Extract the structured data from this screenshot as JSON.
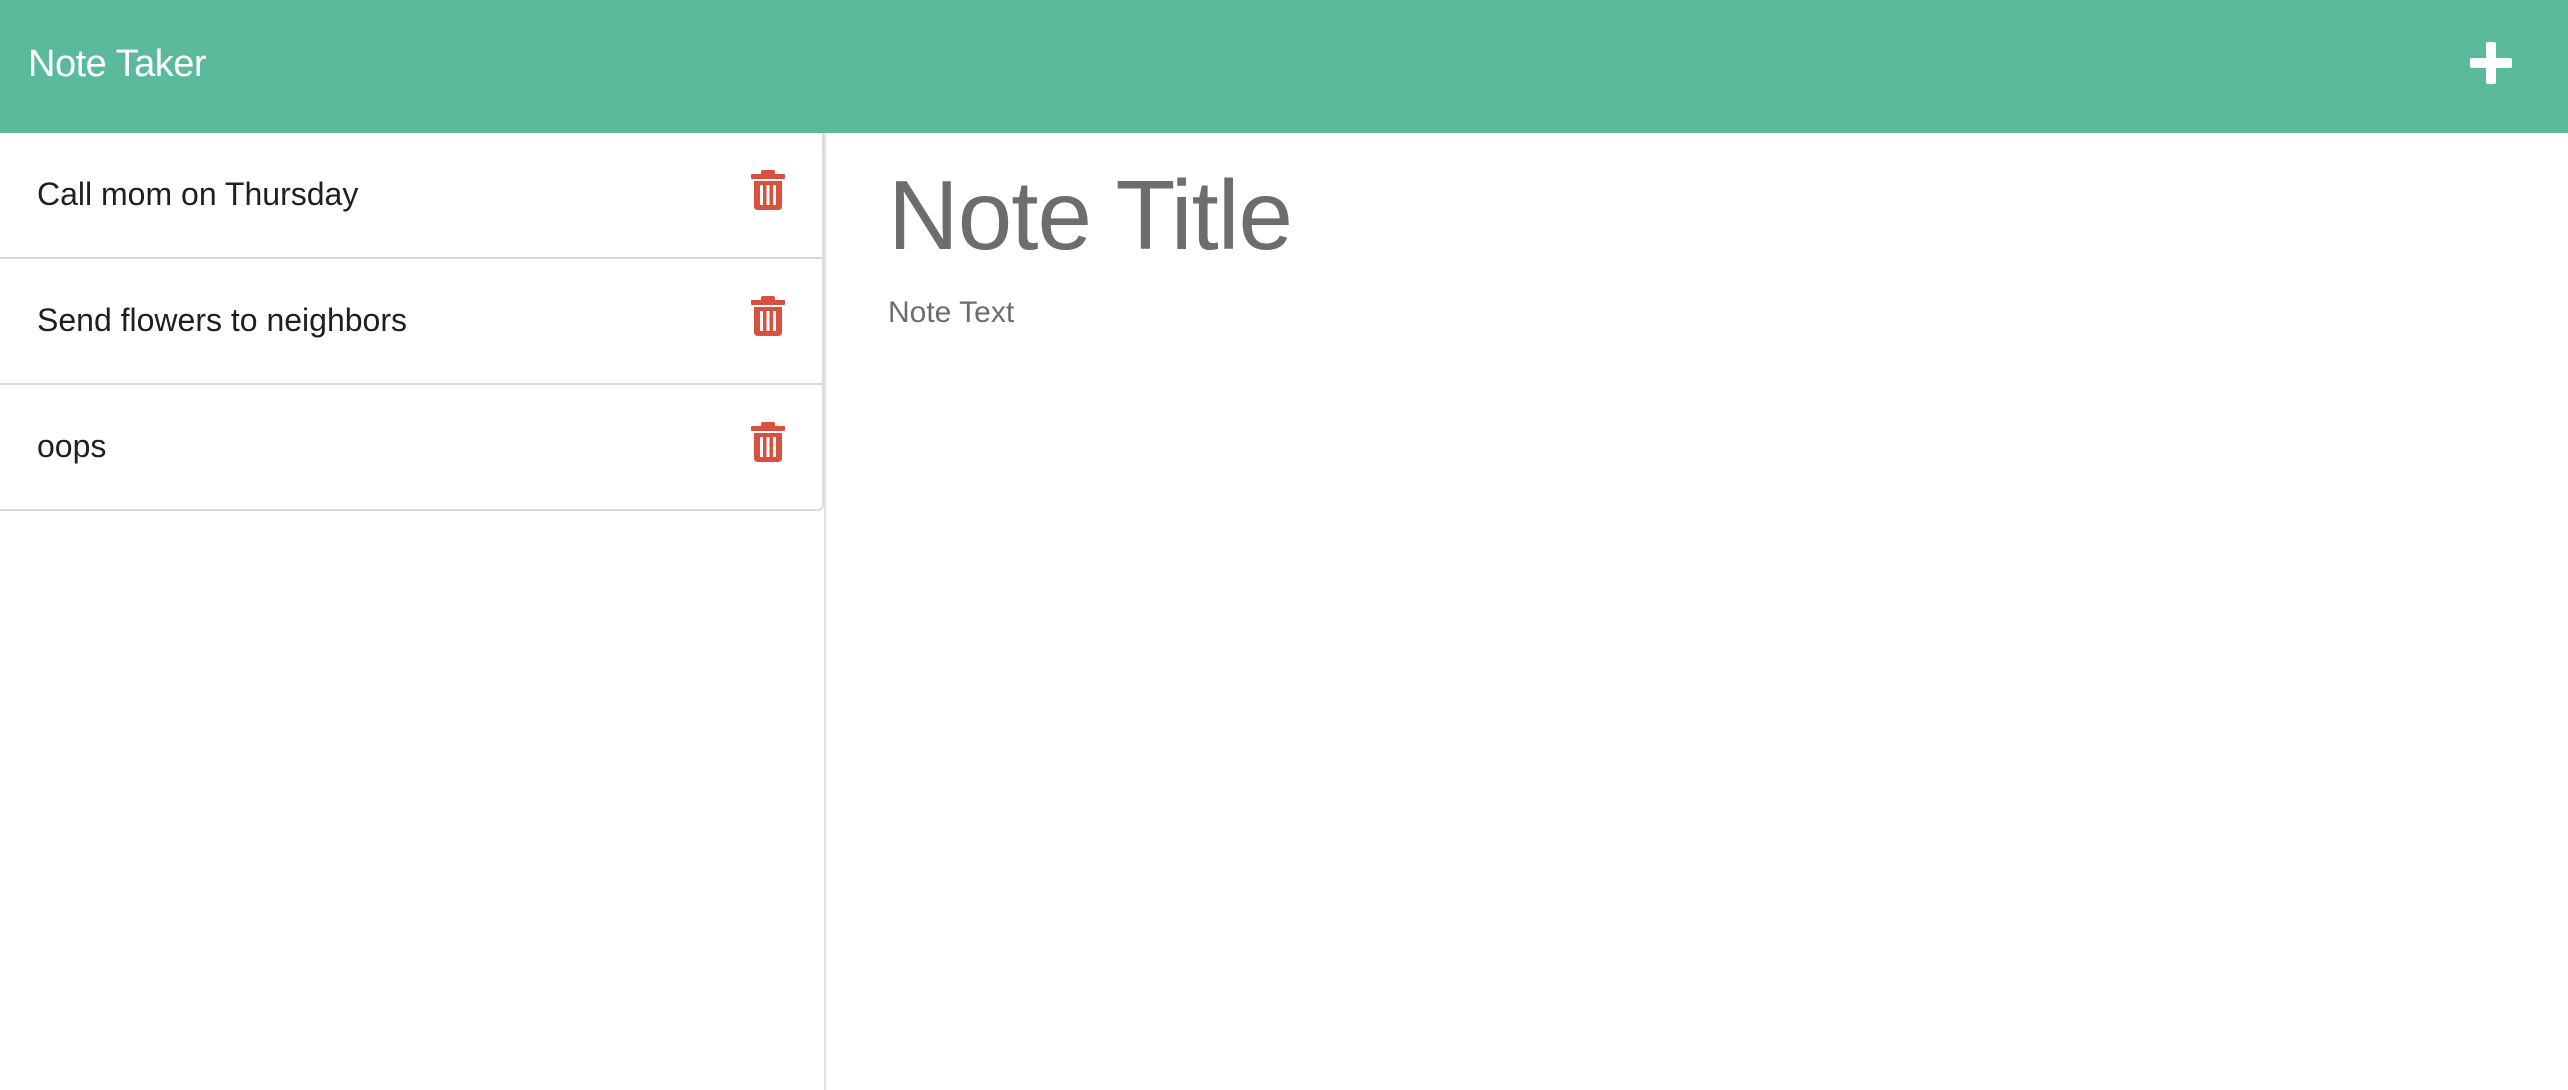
{
  "navbar": {
    "brand": "Note Taker",
    "new_note_icon": "plus-icon"
  },
  "notes": [
    {
      "title": "Call mom on Thursday",
      "delete_icon": "trash-icon"
    },
    {
      "title": "Send flowers to neighbors",
      "delete_icon": "trash-icon"
    },
    {
      "title": "oops",
      "delete_icon": "trash-icon"
    }
  ],
  "editor": {
    "title_placeholder": "Note Title",
    "text_placeholder": "Note Text"
  },
  "colors": {
    "navbar_bg": "#5bba9c",
    "delete_icon": "#d9503f",
    "placeholder_text": "#6d6d6d"
  }
}
